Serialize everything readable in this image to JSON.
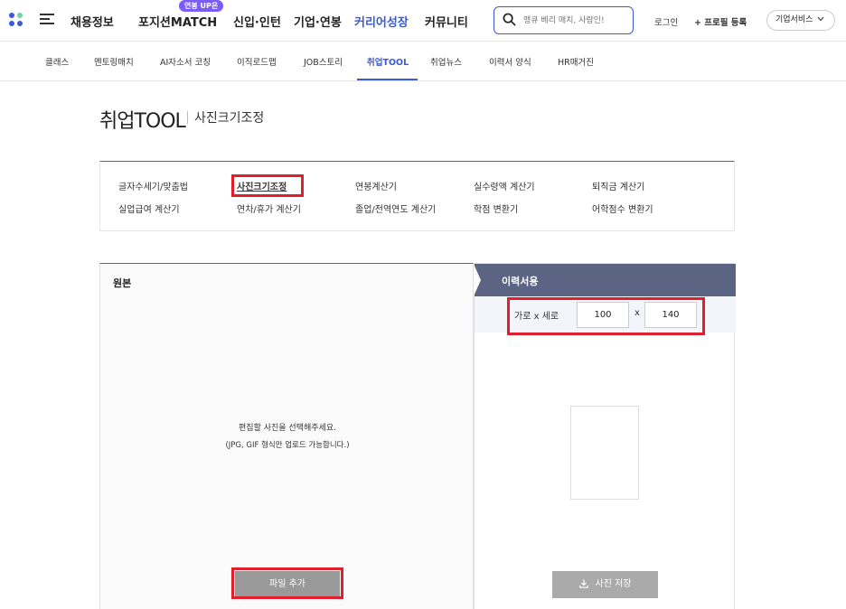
{
  "header": {
    "nav": [
      {
        "label": "채용정보"
      },
      {
        "label": "포지션MATCH",
        "badge": "연봉 UP은"
      },
      {
        "label": "신입·인턴"
      },
      {
        "label": "기업·연봉"
      },
      {
        "label": "커리어성장",
        "active": true
      },
      {
        "label": "커뮤니티"
      }
    ],
    "search_placeholder": "맹큐 베리 매치, 사람인!",
    "login": "로그인",
    "profile_register": "+ 프로필 등록",
    "business_service": "기업서비스"
  },
  "subnav": [
    {
      "label": "클래스"
    },
    {
      "label": "멘토링매치"
    },
    {
      "label": "AI자소서 코칭"
    },
    {
      "label": "이직로드맵"
    },
    {
      "label": "JOB스토리"
    },
    {
      "label": "취업TOOL",
      "active": true
    },
    {
      "label": "취업뉴스"
    },
    {
      "label": "이력서 양식"
    },
    {
      "label": "HR매거진"
    }
  ],
  "page": {
    "title": "취업TOOL",
    "subtitle": "사진크기조정"
  },
  "tools": [
    {
      "label": "글자수세기/맞춤법"
    },
    {
      "label": "사진크기조정",
      "selected": true
    },
    {
      "label": "연봉계산기"
    },
    {
      "label": "실수령액 계산기"
    },
    {
      "label": "퇴직금 계산기"
    },
    {
      "label": "실업급여 계산기"
    },
    {
      "label": "연차/휴가 계산기"
    },
    {
      "label": "졸업/전역연도 계산기"
    },
    {
      "label": "학점 변환기"
    },
    {
      "label": "어학점수 변환기"
    }
  ],
  "original_panel": {
    "heading": "원본",
    "guide_line1": "편집할 사진을 선택해주세요.",
    "guide_line2": "(JPG, GIF 형식만 업로드 가능합니다.)",
    "add_file": "파일 추가"
  },
  "resume_panel": {
    "heading": "이력서용",
    "size_label": "가로 x 세로",
    "width": "100",
    "height": "140",
    "x": "x",
    "save": "사진 저장"
  },
  "colors": {
    "accent": "#3a5bd9",
    "badge": "#7b5cf5",
    "panel_header": "#5c6484",
    "highlight": "#e01e2c"
  }
}
